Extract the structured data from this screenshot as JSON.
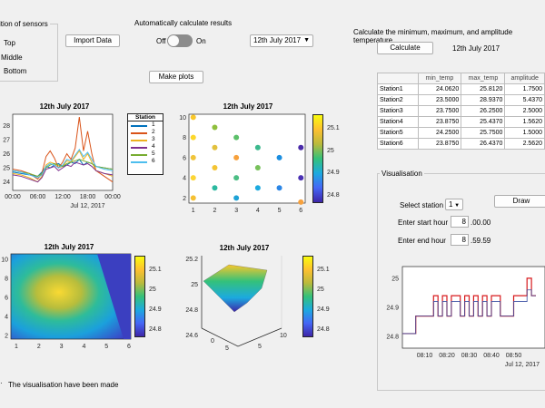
{
  "sensors_panel": {
    "title": "Position of sensors",
    "title_visible": "ition of sensors",
    "options": [
      "Top",
      "Middle",
      "Bottom"
    ],
    "option_labels_visible": [
      "Top",
      "Middle",
      "Bottom"
    ]
  },
  "import_button": "Import Data",
  "auto_calc": {
    "label": "Automatically calculate results",
    "off": "Off",
    "on": "On"
  },
  "date_dropdown": "12th July 2017",
  "make_plots_button": "Make plots",
  "calc_title": "Calculate the minimum, maximum, and amplitude temperature",
  "calculate_button": "Calculate",
  "calc_date": "12th July 2017",
  "table": {
    "headers": [
      "",
      "min_temp",
      "max_temp",
      "amplitude"
    ],
    "rows": [
      [
        "Station1",
        "24.0620",
        "25.8120",
        "1.7500"
      ],
      [
        "Station2",
        "23.5000",
        "28.9370",
        "5.4370"
      ],
      [
        "Station3",
        "23.7500",
        "26.2500",
        "2.5000"
      ],
      [
        "Station4",
        "23.8750",
        "25.4370",
        "1.5620"
      ],
      [
        "Station5",
        "24.2500",
        "25.7500",
        "1.5000"
      ],
      [
        "Station6",
        "23.8750",
        "26.4370",
        "2.5620"
      ]
    ]
  },
  "visualisation": {
    "title": "Visualisation",
    "select_station_label": "Select station",
    "station_value": "1",
    "draw_button": "Draw",
    "start_label": "Enter start hour",
    "start_value": "8",
    "start_suffix": ".00.00",
    "end_label": "Enter end hour",
    "end_value": "8",
    "end_suffix": ".59.59"
  },
  "status_text": "The visualisation have been made",
  "colors": {
    "accent": "#0072bd",
    "red": "#d95319",
    "yellow": "#edb120",
    "purple": "#7e2f8e",
    "green": "#77ac30",
    "cyan": "#4dbeee"
  },
  "chart_data": [
    {
      "type": "line",
      "title": "12th July 2017",
      "x_ticks": [
        "00:00",
        "06:00",
        "12:00",
        "18:00",
        "00:00"
      ],
      "x_sublabel": "Jul 12, 2017",
      "y_ticks": [
        "24",
        "25",
        "26",
        "27",
        "28"
      ],
      "ylim": [
        23.4,
        28.8
      ],
      "legend_title": "Station",
      "legend": [
        "1",
        "2",
        "3",
        "4",
        "5",
        "6"
      ],
      "x": [
        0,
        2,
        4,
        6,
        7,
        8,
        9,
        10,
        11,
        12,
        13,
        14,
        15,
        16,
        17,
        18,
        19,
        20,
        22,
        24
      ],
      "series": [
        {
          "name": "1",
          "color": "#0072bd",
          "values": [
            24.7,
            24.6,
            24.5,
            24.4,
            24.7,
            25.1,
            25.0,
            25.2,
            25.3,
            25.1,
            25.2,
            25.4,
            25.3,
            25.6,
            25.2,
            25.4,
            25.3,
            25.1,
            25.0,
            24.9
          ]
        },
        {
          "name": "2",
          "color": "#d95319",
          "values": [
            24.9,
            24.8,
            24.6,
            24.2,
            24.6,
            25.8,
            26.2,
            25.7,
            25.0,
            25.4,
            26.0,
            25.6,
            26.4,
            28.6,
            26.2,
            27.6,
            26.0,
            24.8,
            24.4,
            24.0
          ]
        },
        {
          "name": "3",
          "color": "#edb120",
          "values": [
            24.6,
            24.5,
            24.3,
            24.0,
            24.4,
            25.2,
            25.4,
            25.3,
            25.0,
            25.1,
            25.5,
            25.4,
            25.8,
            26.2,
            25.6,
            26.0,
            25.4,
            24.8,
            24.6,
            24.4
          ]
        },
        {
          "name": "4",
          "color": "#7e2f8e",
          "values": [
            24.5,
            24.4,
            24.2,
            24.0,
            24.3,
            24.9,
            25.0,
            25.1,
            24.8,
            25.0,
            25.2,
            25.1,
            25.4,
            25.3,
            25.2,
            25.3,
            25.1,
            24.8,
            24.6,
            24.5
          ]
        },
        {
          "name": "5",
          "color": "#77ac30",
          "values": [
            24.8,
            24.7,
            24.6,
            24.4,
            24.6,
            25.0,
            25.2,
            25.3,
            25.2,
            25.1,
            25.3,
            25.4,
            25.5,
            25.6,
            25.5,
            25.4,
            25.3,
            25.1,
            25.0,
            24.9
          ]
        },
        {
          "name": "6",
          "color": "#4dbeee",
          "values": [
            24.8,
            24.7,
            24.5,
            24.3,
            24.5,
            25.1,
            25.3,
            25.2,
            25.0,
            25.2,
            25.6,
            25.5,
            25.9,
            26.3,
            25.8,
            26.1,
            25.6,
            25.1,
            24.9,
            24.8
          ]
        }
      ]
    },
    {
      "type": "scatter",
      "title": "12th July 2017",
      "xlim": [
        0.8,
        6.2
      ],
      "ylim": [
        1.5,
        10.3
      ],
      "x_ticks": [
        "1",
        "2",
        "3",
        "4",
        "5",
        "6"
      ],
      "y_ticks": [
        "2",
        "4",
        "6",
        "8",
        "10"
      ],
      "colorbar_ticks": [
        "24.8",
        "24.9",
        "25",
        "25.1"
      ],
      "points": [
        {
          "x": 1,
          "y": 10,
          "c": "#f9c72a"
        },
        {
          "x": 1,
          "y": 8,
          "c": "#fcd72b"
        },
        {
          "x": 1,
          "y": 6,
          "c": "#f0c43a"
        },
        {
          "x": 1,
          "y": 4,
          "c": "#fcd535"
        },
        {
          "x": 1,
          "y": 2,
          "c": "#f5c033"
        },
        {
          "x": 2,
          "y": 9,
          "c": "#8fbf3d"
        },
        {
          "x": 2,
          "y": 7,
          "c": "#e2c13e"
        },
        {
          "x": 2,
          "y": 5,
          "c": "#f4c433"
        },
        {
          "x": 2,
          "y": 3,
          "c": "#2cb9a0"
        },
        {
          "x": 3,
          "y": 8,
          "c": "#5cc06a"
        },
        {
          "x": 3,
          "y": 6,
          "c": "#f7a13c"
        },
        {
          "x": 3,
          "y": 4,
          "c": "#4cbe85"
        },
        {
          "x": 3,
          "y": 2,
          "c": "#1ea2d6"
        },
        {
          "x": 4,
          "y": 7,
          "c": "#3bb98d"
        },
        {
          "x": 4,
          "y": 5,
          "c": "#77c15b"
        },
        {
          "x": 4,
          "y": 3,
          "c": "#1caadf"
        },
        {
          "x": 5,
          "y": 6,
          "c": "#1b8ee0"
        },
        {
          "x": 5,
          "y": 3,
          "c": "#2b86e6"
        },
        {
          "x": 6,
          "y": 7,
          "c": "#4a2aa8"
        },
        {
          "x": 6,
          "y": 4,
          "c": "#4a30b3"
        },
        {
          "x": 6,
          "y": 1.6,
          "c": "#f7a13c"
        }
      ]
    },
    {
      "type": "heatmap",
      "title": "12th July 2017",
      "x_ticks": [
        "1",
        "2",
        "3",
        "4",
        "5",
        "6"
      ],
      "y_ticks": [
        "2",
        "4",
        "6",
        "8",
        "10"
      ],
      "colorbar_ticks": [
        "24.8",
        "24.9",
        "25",
        "25.1"
      ]
    },
    {
      "type": "surface",
      "title": "12th July 2017",
      "z_ticks": [
        "24.6",
        "24.8",
        "25",
        "25.2"
      ],
      "x_ticks": [
        "0",
        "5"
      ],
      "y_ticks": [
        "5",
        "10"
      ],
      "colorbar_ticks": [
        "24.8",
        "24.9",
        "25",
        "25.1"
      ]
    },
    {
      "type": "line",
      "title": "",
      "x_ticks": [
        "08:10",
        "08:20",
        "08:30",
        "08:40",
        "08:50"
      ],
      "x_sublabel": "Jul 12, 2017",
      "y_ticks": [
        "24.8",
        "24.9",
        "25"
      ],
      "ylim": [
        24.76,
        25.04
      ],
      "x": [
        0,
        2,
        4,
        6,
        8,
        10,
        12,
        14,
        16,
        18,
        20,
        22,
        24,
        26,
        28,
        30,
        32,
        34,
        36,
        38,
        40,
        42,
        44,
        46,
        48,
        50,
        52,
        54,
        56,
        58,
        60
      ],
      "series": [
        {
          "name": "",
          "color": "#d7191c",
          "values": [
            24.81,
            24.81,
            24.81,
            24.87,
            24.87,
            24.87,
            24.87,
            24.94,
            24.87,
            24.94,
            24.87,
            24.94,
            24.94,
            24.87,
            24.94,
            24.87,
            24.94,
            24.87,
            24.94,
            24.87,
            24.94,
            24.94,
            24.87,
            24.87,
            24.87,
            24.94,
            24.94,
            24.94,
            25.0,
            24.94,
            24.94
          ]
        },
        {
          "name": "",
          "color": "#3b4fa3",
          "values": [
            24.81,
            24.81,
            24.81,
            24.87,
            24.87,
            24.87,
            24.87,
            24.92,
            24.87,
            24.92,
            24.87,
            24.92,
            24.92,
            24.87,
            24.92,
            24.87,
            24.92,
            24.87,
            24.92,
            24.87,
            24.92,
            24.92,
            24.87,
            24.87,
            24.87,
            24.92,
            24.92,
            24.92,
            24.96,
            24.94,
            24.94
          ]
        }
      ]
    }
  ]
}
